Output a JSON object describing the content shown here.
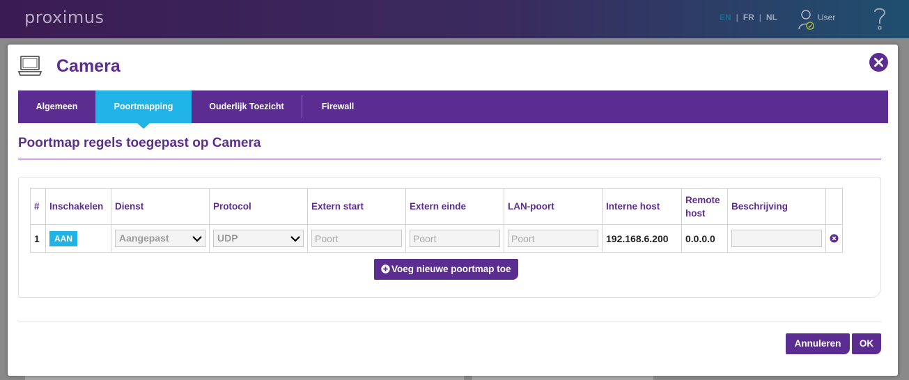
{
  "header": {
    "logo": "proximus",
    "languages": [
      "EN",
      "FR",
      "NL"
    ],
    "active_language": "EN",
    "user_label": "User"
  },
  "modal": {
    "title": "Camera",
    "tabs": [
      {
        "label": "Algemeen",
        "active": false
      },
      {
        "label": "Poortmapping",
        "active": true
      },
      {
        "label": "Ouderlijk Toezicht",
        "active": false
      },
      {
        "label": "Firewall",
        "active": false
      }
    ],
    "section_title": "Poortmap regels toegepast op Camera",
    "table": {
      "headers": [
        "#",
        "Inschakelen",
        "Dienst",
        "Protocol",
        "Extern start",
        "Extern einde",
        "LAN-poort",
        "Interne host",
        "Remote host",
        "Beschrijving",
        ""
      ],
      "rows": [
        {
          "index": "1",
          "enabled": "AAN",
          "service": "Aangepast",
          "protocol": "UDP",
          "extern_start_placeholder": "Poort",
          "extern_end_placeholder": "Poort",
          "lan_port_placeholder": "Poort",
          "internal_host": "192.168.6.200",
          "remote_host": "0.0.0.0",
          "description": ""
        }
      ]
    },
    "add_button": "Voeg nieuwe poortmap toe",
    "cancel_button": "Annuleren",
    "ok_button": "OK"
  },
  "colors": {
    "brand_purple": "#5c2d91",
    "accent_blue": "#1fb3e8"
  }
}
